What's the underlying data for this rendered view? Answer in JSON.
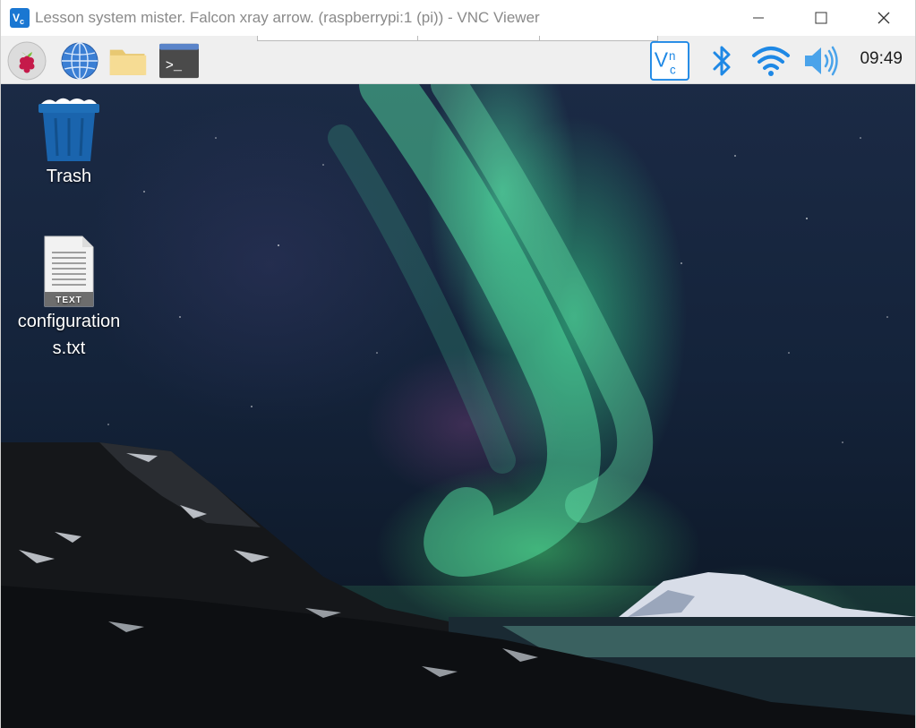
{
  "window": {
    "title": "Lesson system mister. Falcon xray arrow. (raspberrypi:1 (pi)) - VNC Viewer",
    "app_icon": "vnc-viewer-icon",
    "controls": [
      "minimize-icon",
      "maximize-icon",
      "close-icon"
    ]
  },
  "taskbar": {
    "launchers": [
      {
        "name": "raspberry-menu",
        "icon": "raspberry-icon"
      },
      {
        "name": "web-browser",
        "icon": "globe-icon"
      },
      {
        "name": "file-manager",
        "icon": "folder-icon"
      },
      {
        "name": "terminal",
        "icon": "terminal-icon",
        "glyph": ">_"
      }
    ],
    "tray": [
      {
        "name": "vnc-server",
        "icon": "vnc-icon"
      },
      {
        "name": "bluetooth",
        "icon": "bluetooth-icon"
      },
      {
        "name": "wifi",
        "icon": "wifi-icon"
      },
      {
        "name": "volume",
        "icon": "volume-icon"
      }
    ],
    "clock": "09:49"
  },
  "desktop": {
    "icons": [
      {
        "label": "Trash",
        "icon": "trash-icon"
      },
      {
        "label_line1": "configuration",
        "label_line2": "s.txt",
        "icon": "text-file-icon",
        "badge": "TEXT"
      }
    ],
    "wallpaper": "aurora-landscape"
  },
  "colors": {
    "accent": "#1a77d2",
    "tray_blue": "#1e88e5",
    "taskbar_bg": "#efefef",
    "aurora_green": "#3ee69a"
  }
}
